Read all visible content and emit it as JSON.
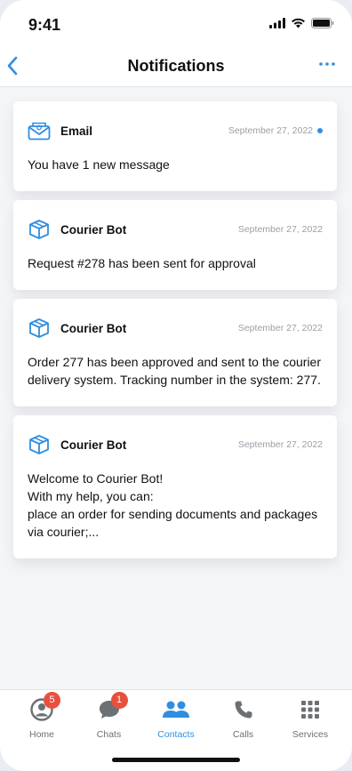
{
  "status_bar": {
    "time": "9:41"
  },
  "header": {
    "title": "Notifications"
  },
  "notifications": [
    {
      "sender": "Email",
      "date": "September 27, 2022",
      "unread": true,
      "icon": "envelope-icon",
      "message": "You have 1 new message"
    },
    {
      "sender": "Courier Bot",
      "date": "September 27, 2022",
      "unread": false,
      "icon": "box-icon",
      "message": "Request #278 has been sent for approval"
    },
    {
      "sender": "Courier Bot",
      "date": "September 27, 2022",
      "unread": false,
      "icon": "box-icon",
      "message": "Order 277 has been approved and sent to the courier delivery system. Tracking number in the system: 277."
    },
    {
      "sender": "Courier Bot",
      "date": "September 27, 2022",
      "unread": false,
      "icon": "box-icon",
      "message": "Welcome to Courier Bot!\nWith my help, you can:\nplace an order for sending documents and packages via courier;..."
    }
  ],
  "nav": {
    "items": [
      {
        "label": "Home",
        "icon": "user-circle-icon",
        "badge": "5",
        "active": false
      },
      {
        "label": "Chats",
        "icon": "chat-bubble-icon",
        "badge": "1",
        "active": false
      },
      {
        "label": "Contacts",
        "icon": "contacts-icon",
        "badge": "",
        "active": true
      },
      {
        "label": "Calls",
        "icon": "phone-icon",
        "badge": "",
        "active": false
      },
      {
        "label": "Services",
        "icon": "grid-icon",
        "badge": "",
        "active": false
      }
    ]
  },
  "colors": {
    "accent": "#2f8ee0",
    "badge": "#e8503e",
    "background": "#f4f5f7"
  }
}
